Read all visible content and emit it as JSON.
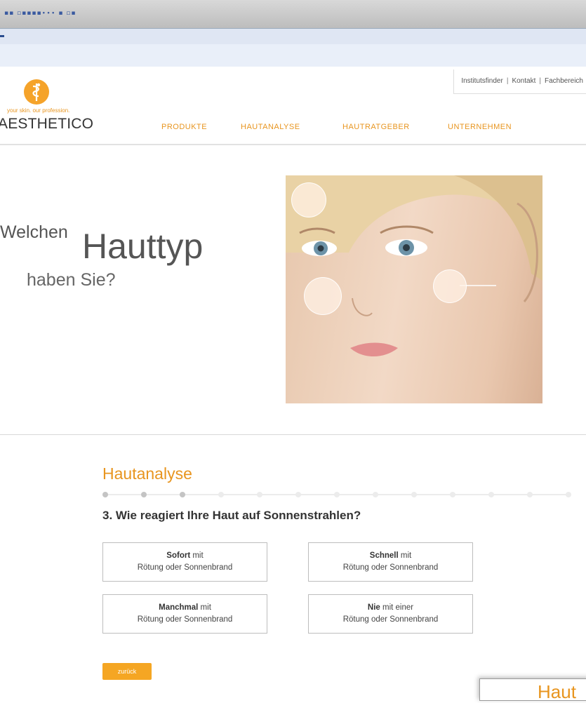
{
  "browser": {
    "glyphs": "▪▪   ▫▪▪▪▪∙∙∙  ▪  ▫▪"
  },
  "utility_nav": {
    "items": [
      "Institutsfinder",
      "Kontakt",
      "Fachbereich"
    ],
    "separator": "|"
  },
  "brand": {
    "tagline": "your skin. our profession.",
    "name": "AESTHETICO"
  },
  "main_nav": {
    "items": [
      "PRODUKTE",
      "HAUTANALYSE",
      "HAUTRATGEBER",
      "UNTERNEHMEN"
    ]
  },
  "hero": {
    "line1": "Welchen",
    "line2": "Hauttyp",
    "line3": "haben Sie?"
  },
  "quiz": {
    "title": "Hautanalyse",
    "progress": {
      "current_step": 3,
      "total_steps": 13
    },
    "question": "3. Wie reagiert Ihre Haut auf Sonnenstrahlen?",
    "answers": [
      {
        "bold": "Sofort",
        "rest": " mit",
        "line2": "Rötung oder Sonnenbrand"
      },
      {
        "bold": "Schnell",
        "rest": " mit",
        "line2": "Rötung oder Sonnenbrand"
      },
      {
        "bold": "Manchmal",
        "rest": " mit",
        "line2": "Rötung oder Sonnenbrand"
      },
      {
        "bold": "Nie",
        "rest": " mit einer",
        "line2": "Rötung oder Sonnenbrand"
      }
    ],
    "back_label": "zurück"
  },
  "popup": {
    "text": "Haut"
  },
  "colors": {
    "accent": "#e8951f",
    "button": "#f5a623"
  }
}
